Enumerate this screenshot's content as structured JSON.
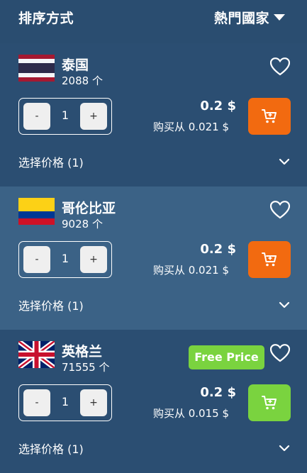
{
  "header": {
    "sort_label": "排序方式",
    "popular_label": "熱門國家"
  },
  "colors": {
    "background": "#2a4d70",
    "card_alt": "#3b6286",
    "cart_orange": "#f26a10",
    "free_green": "#7ad33f"
  },
  "countries": [
    {
      "name": "泰国",
      "count": "2088 个",
      "flag": "thailand",
      "quantity": "1",
      "minus": "-",
      "plus": "+",
      "price": "0.2 $",
      "from_price": "购买从 0.021 $",
      "select_price": "选择价格 (1)",
      "cart_color": "orange",
      "badge": ""
    },
    {
      "name": "哥伦比亚",
      "count": "9028 个",
      "flag": "colombia",
      "quantity": "1",
      "minus": "-",
      "plus": "+",
      "price": "0.2 $",
      "from_price": "购买从 0.021 $",
      "select_price": "选择价格 (1)",
      "cart_color": "orange",
      "badge": ""
    },
    {
      "name": "英格兰",
      "count": "71555 个",
      "flag": "united-kingdom",
      "quantity": "1",
      "minus": "-",
      "plus": "+",
      "price": "0.2 $",
      "from_price": "购买从 0.015 $",
      "select_price": "选择价格 (1)",
      "cart_color": "green",
      "badge": "Free Price"
    }
  ]
}
